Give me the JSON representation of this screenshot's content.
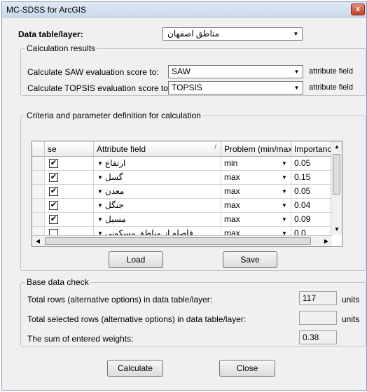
{
  "window": {
    "title": "MC-SDSS for ArcGIS",
    "close_glyph": "x"
  },
  "datatable": {
    "label": "Data table/layer:",
    "value": "مناطق اصفهان"
  },
  "calc_results": {
    "legend": "Calculation results",
    "saw_label": "Calculate SAW evaluation score to:",
    "saw_value": "SAW",
    "saw_suffix": "attribute field",
    "topsis_label": "Calculate TOPSIS evaluation score to:",
    "topsis_value": "TOPSIS",
    "topsis_suffix": "attribute field"
  },
  "criteria": {
    "legend": "Criteria and parameter definition for calculation",
    "columns": {
      "use": "se",
      "attribute": "Attribute field",
      "sort": "/",
      "problem": "Problem (min/max)",
      "importance": "Importance"
    },
    "rows": [
      {
        "checked": "✔",
        "attribute": "ارتفاع",
        "problem": "min",
        "importance": "0.05"
      },
      {
        "checked": "✔",
        "attribute": "گسل",
        "problem": "max",
        "importance": "0.15"
      },
      {
        "checked": "✔",
        "attribute": "معدن",
        "problem": "max",
        "importance": "0.05"
      },
      {
        "checked": "✔",
        "attribute": "جنگل",
        "problem": "max",
        "importance": "0.04"
      },
      {
        "checked": "✔",
        "attribute": "مسیل",
        "problem": "max",
        "importance": "0.09"
      },
      {
        "checked": "",
        "attribute": "فاصله از مناطق مسکونی",
        "problem": "max",
        "importance": "0.0"
      }
    ]
  },
  "buttons": {
    "load": "Load",
    "save": "Save",
    "calculate": "Calculate",
    "close": "Close"
  },
  "base_check": {
    "legend": "Base data check",
    "total_rows_label": "Total rows (alternative options) in data table/layer:",
    "total_rows_value": "117",
    "total_rows_unit": "units",
    "selected_rows_label": "Total selected rows (alternative options) in data table/layer:",
    "selected_rows_value": "",
    "selected_rows_unit": "units",
    "sum_label": "The sum of entered weights:",
    "sum_value": "0.38"
  }
}
